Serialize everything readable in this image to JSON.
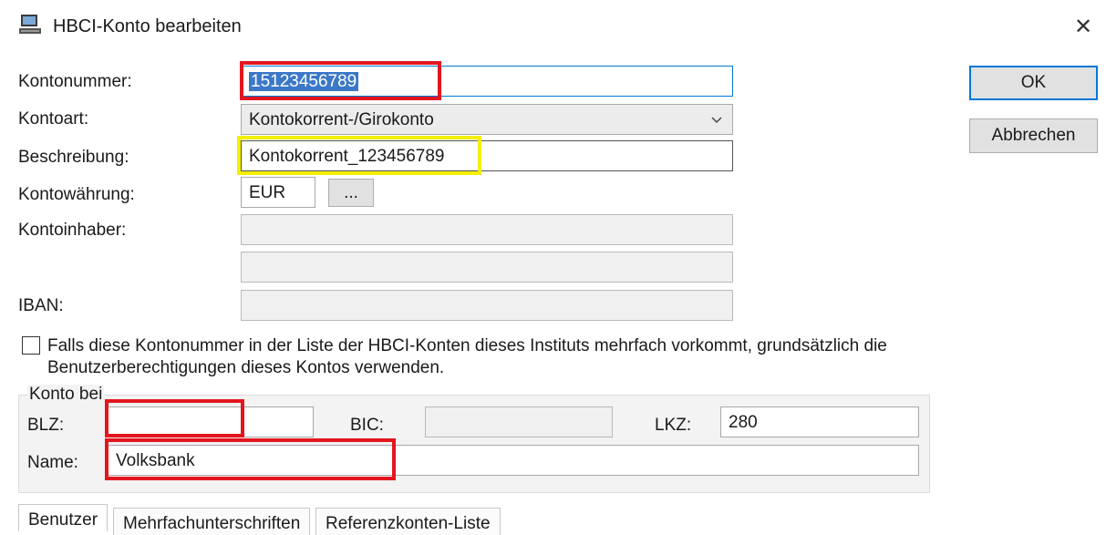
{
  "dialog": {
    "title": "HBCI-Konto bearbeiten",
    "close_glyph": "✕",
    "ok_label": "OK",
    "cancel_label": "Abbrechen"
  },
  "form": {
    "kontonummer_label": "Kontonummer:",
    "kontonummer_value": "15123456789",
    "kontoart_label": "Kontoart:",
    "kontoart_value": "Kontokorrent-/Girokonto",
    "beschreibung_label": "Beschreibung:",
    "beschreibung_value": "Kontokorrent_123456789",
    "waehrung_label": "Kontowährung:",
    "waehrung_value": "EUR",
    "waehrung_button": "...",
    "inhaber_label": "Kontoinhaber:",
    "iban_label": "IBAN:",
    "checkbox_text_line1": "Falls diese Kontonummer in der Liste der HBCI-Konten dieses Instituts mehrfach vorkommt, grundsätzlich die",
    "checkbox_text_line2": "Benutzerberechtigungen dieses Kontos verwenden."
  },
  "bank": {
    "group_label": "Konto bei",
    "blz_label": "BLZ:",
    "blz_value": "",
    "bic_label": "BIC:",
    "lkz_label": "LKZ:",
    "lkz_value": "280",
    "name_label": "Name:",
    "name_value": "Volksbank"
  },
  "tabs": [
    {
      "label": "Benutzer"
    },
    {
      "label": "Mehrfachunterschriften"
    },
    {
      "label": "Referenzkonten-Liste"
    }
  ]
}
